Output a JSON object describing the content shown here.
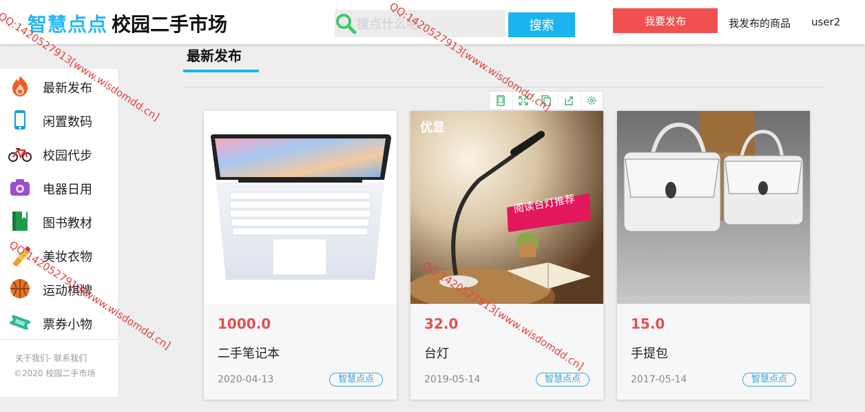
{
  "header": {
    "brand": "智慧点点",
    "title": "校园二手市场",
    "search_placeholder": "搜点什么吧~",
    "search_button": "搜索",
    "publish_button": "我要发布",
    "my_items": "我发布的商品",
    "username": "user2"
  },
  "sidebar": {
    "items": [
      {
        "label": "最新发布",
        "icon": "fire-icon"
      },
      {
        "label": "闲置数码",
        "icon": "phone-icon"
      },
      {
        "label": "校园代步",
        "icon": "bicycle-icon"
      },
      {
        "label": "电器日用",
        "icon": "camera-icon"
      },
      {
        "label": "图书教材",
        "icon": "book-icon"
      },
      {
        "label": "美妆衣物",
        "icon": "lipstick-icon"
      },
      {
        "label": "运动棋牌",
        "icon": "basketball-icon"
      },
      {
        "label": "票券小物",
        "icon": "ticket-icon"
      }
    ],
    "footer_links": "关于我们- 联系我们",
    "footer_copyright": "©2020 校园二手市场"
  },
  "section": {
    "title": "最新发布"
  },
  "toolbar": {
    "icons": [
      "tablet-icon",
      "expand-icon",
      "copy-icon",
      "share-icon",
      "settings-icon"
    ]
  },
  "products": [
    {
      "price": "1000.0",
      "name": "二手笔记本",
      "date": "2020-04-13",
      "tag": "智慧点点",
      "image": "laptop-image"
    },
    {
      "price": "32.0",
      "name": "台灯",
      "date": "2019-05-14",
      "tag": "智慧点点",
      "image": "desk-lamp-image",
      "overlay_brand": "优显",
      "overlay_banner": "阅读台灯推荐"
    },
    {
      "price": "15.0",
      "name": "手提包",
      "date": "2017-05-14",
      "tag": "智慧点点",
      "image": "handbags-image"
    }
  ],
  "watermark": "QQ:1420527913[www.wisdomdd.cn]",
  "colors": {
    "brand_blue": "#29b6f6",
    "search_blue": "#1ab4f0",
    "publish_red": "#f05050",
    "price_red": "#e05050",
    "tag_blue": "#3aa6d8"
  }
}
